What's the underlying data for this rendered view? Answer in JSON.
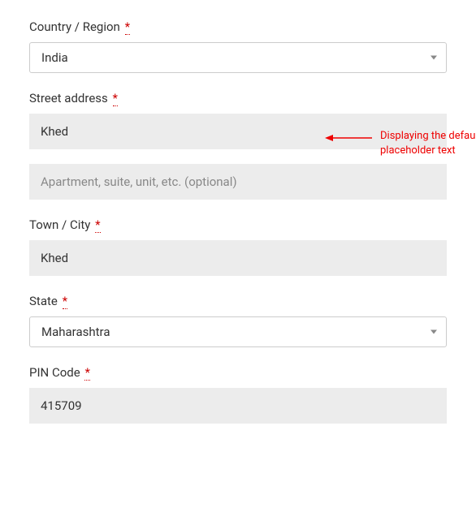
{
  "country": {
    "label": "Country / Region",
    "required": "*",
    "value": "India"
  },
  "street": {
    "label": "Street address",
    "required": "*",
    "line1_value": "Khed",
    "line2_placeholder": "Apartment, suite, unit, etc. (optional)"
  },
  "city": {
    "label": "Town / City",
    "required": "*",
    "value": "Khed"
  },
  "state": {
    "label": "State",
    "required": "*",
    "value": "Maharashtra"
  },
  "pincode": {
    "label": "PIN Code",
    "required": "*",
    "value": "415709"
  },
  "annotation": {
    "text": "Displaying the default placeholder text"
  }
}
